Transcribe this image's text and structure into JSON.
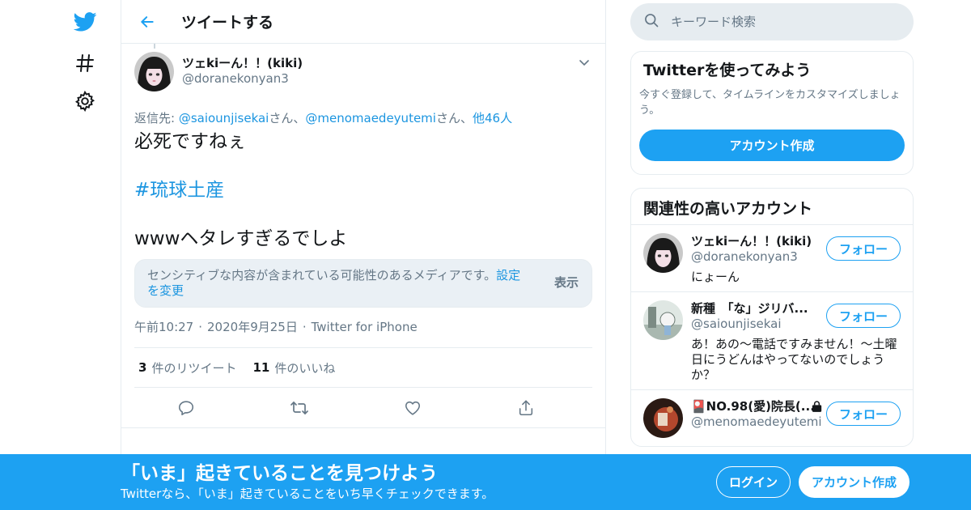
{
  "nav": {
    "items": [
      {
        "icon": "twitter-bird-icon"
      },
      {
        "icon": "hashtag-explore-icon"
      },
      {
        "icon": "gear-settings-icon"
      }
    ]
  },
  "header": {
    "title": "ツイートする"
  },
  "tweet": {
    "author_name": "ツェkiーん！！(kiki)",
    "author_handle": "@doranekonyan3",
    "reply_prefix": "返信先: ",
    "reply_user1": "@saiounjisekai",
    "reply_sep1": "さん、",
    "reply_user2": "@menomaedeyutemi",
    "reply_sep2": "さん、",
    "reply_others": "他46人",
    "text_line1": "必死ですねぇ",
    "hashtag": "#琉球土産",
    "text_line3": "wwwヘタレすぎるでしよ",
    "sensitive_notice": "センシティブな内容が含まれている可能性のあるメディアです。",
    "sensitive_link": "設定を変更",
    "sensitive_show": "表示",
    "time": "午前10:27",
    "date": "2020年9月25日",
    "source": "Twitter for iPhone",
    "dot": "·",
    "retweet_count": "3",
    "retweet_label": "件のリツイート",
    "like_count": "11",
    "like_label": "件のいいね"
  },
  "sidebar": {
    "search_placeholder": "キーワード検索",
    "try_title": "Twitterを使ってみよう",
    "try_desc": "今すぐ登録して、タイムラインをカスタマイズしましょう。",
    "try_button": "アカウント作成",
    "related_title": "関連性の高いアカウント",
    "follow_label": "フォロー",
    "accounts": [
      {
        "name": "ツェkiーん！！(kiki)",
        "handle": "@doranekonyan3",
        "bio": "にょーん"
      },
      {
        "name": "新種　「な」ジリバ...",
        "handle": "@saiounjisekai",
        "bio": "あ！あの～電話ですみません！～土曜日にうどんはやってないのでしょうか？"
      },
      {
        "name": "🎴NO.98(愛)院長(...",
        "handle": "@menomaedeyutemi",
        "bio": ""
      }
    ]
  },
  "banner": {
    "title": "「いま」起きていることを見つけよう",
    "subtitle": "Twitterなら、「いま」起きていることをいち早くチェックできます。",
    "login": "ログイン",
    "signup": "アカウント作成"
  },
  "colors": {
    "accent": "#1da1f2",
    "link": "#1b95e0",
    "secondary_text": "#657786",
    "border": "#e6ecf0"
  }
}
